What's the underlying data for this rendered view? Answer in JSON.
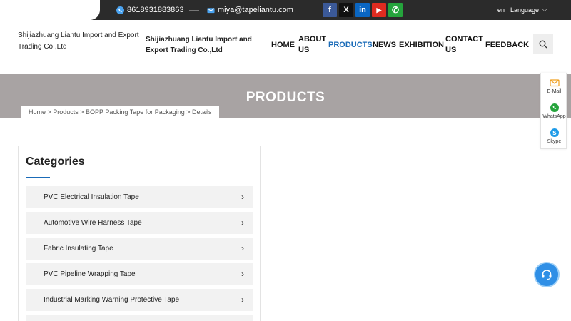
{
  "topbar": {
    "phone": "8618931883863",
    "email": "miya@tapeliantu.com",
    "social": [
      {
        "icon": "facebook-icon",
        "glyph": "f",
        "color": "#3b5998"
      },
      {
        "icon": "x-icon",
        "glyph": "X",
        "color": "#111111"
      },
      {
        "icon": "linkedin-icon",
        "glyph": "in",
        "color": "#0a66c2"
      },
      {
        "icon": "youtube-icon",
        "glyph": "▶",
        "color": "#e02b20"
      },
      {
        "icon": "whatsapp-icon",
        "glyph": "✆",
        "color": "#25a43c"
      }
    ],
    "lang_code": "en",
    "lang_label": "Language"
  },
  "header": {
    "logo_text": "Shijiazhuang Liantu Import and Export Trading Co.,Ltd",
    "brand_text": "Shijiazhuang Liantu Import and Export Trading Co.,Ltd"
  },
  "nav": {
    "home": "HOME",
    "about_line1": "ABOUT",
    "about_line2": "US",
    "products": "PRODUCTS",
    "news": "NEWS",
    "exhibition": "EXHIBITION",
    "contact_line1": "CONTACT",
    "contact_line2": "US",
    "feedback": "FEEDBACK"
  },
  "banner": {
    "title": "PRODUCTS",
    "breadcrumb": "Home > Products > BOPP Packing Tape for Packaging > Details"
  },
  "float": {
    "email": "E-Mail",
    "whatsapp": "WhatsApp",
    "skype": "Skype"
  },
  "categories": {
    "title": "Categories",
    "items": [
      "PVC Electrical Insulation Tape",
      "Automotive Wire Harness Tape",
      "Fabric Insulating Tape",
      "PVC Pipeline Wrapping Tape",
      "Industrial Marking Warning Protective Tape"
    ]
  },
  "colors": {
    "accent": "#1a6bb8",
    "topbar": "#2b2b2b",
    "banner": "#a8a3a3"
  }
}
